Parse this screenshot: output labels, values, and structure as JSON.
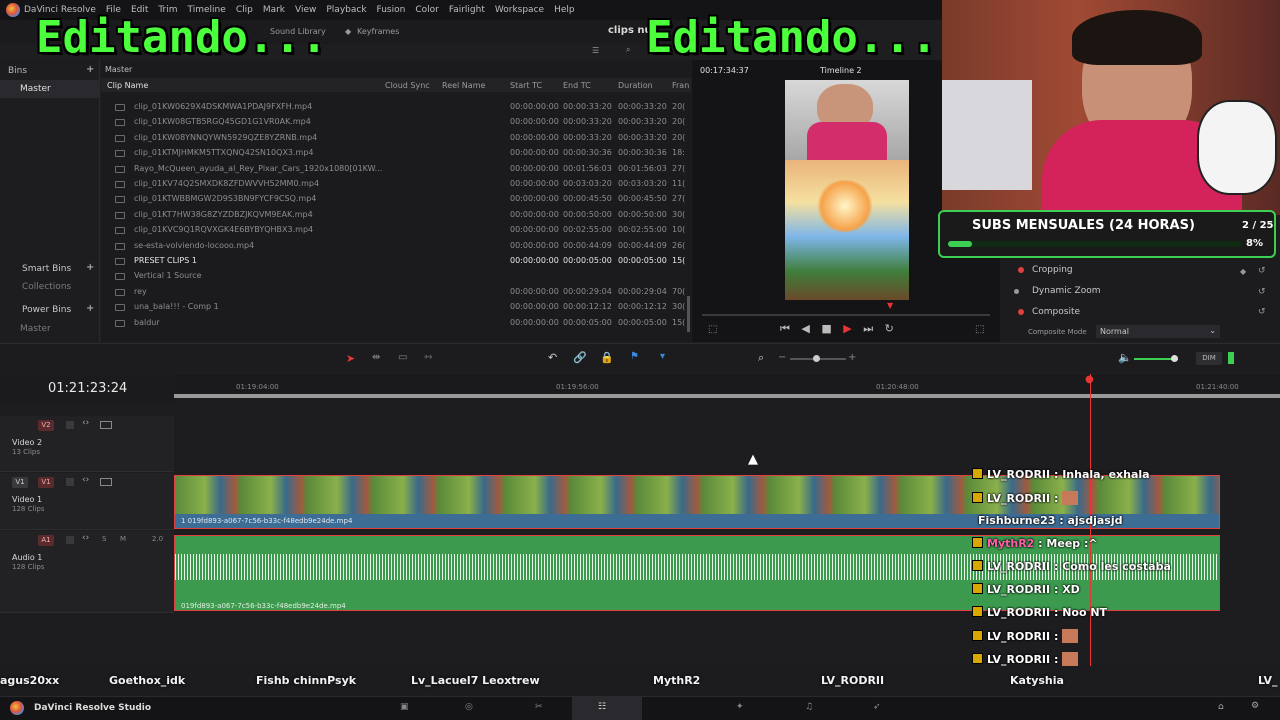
{
  "app": {
    "name": "DaVinci Resolve",
    "taskbar_label": "DaVinci Resolve Studio"
  },
  "menu": [
    "File",
    "Edit",
    "Trim",
    "Timeline",
    "Clip",
    "Mark",
    "View",
    "Playback",
    "Fusion",
    "Color",
    "Fairlight",
    "Workspace",
    "Help"
  ],
  "toolbar": {
    "sound_library": "Sound Library",
    "keyframes": "Keyframes",
    "project_title": "clips nue"
  },
  "overlay_text": {
    "left": "Editando...",
    "right": "Editando..."
  },
  "bins": {
    "header": "Bins",
    "master": "Master",
    "smart_bins": "Smart Bins",
    "collections": "Collections",
    "power_bins": "Power Bins",
    "power_master": "Master"
  },
  "pool": {
    "breadcrumb": "Master",
    "columns": [
      "Clip Name",
      "Cloud Sync",
      "Reel Name",
      "Start TC",
      "End TC",
      "Duration",
      "Fran"
    ],
    "clips": [
      {
        "name": "clip_01KW0629X4DSKMWA1PDAJ9FXFH.mp4",
        "start": "00:00:00:00",
        "end": "00:00:33:20",
        "dur": "00:00:33:20",
        "fr": "20("
      },
      {
        "name": "clip_01KW08GTB5RGQ45GD1G1VR0AK.mp4",
        "start": "00:00:00:00",
        "end": "00:00:33:20",
        "dur": "00:00:33:20",
        "fr": "20("
      },
      {
        "name": "clip_01KW08YNNQYWN5929QZE8YZRNB.mp4",
        "start": "00:00:00:00",
        "end": "00:00:33:20",
        "dur": "00:00:33:20",
        "fr": "20("
      },
      {
        "name": "clip_01KTMJHMKM5TTXQNQ42SN10QX3.mp4",
        "start": "00:00:00:00",
        "end": "00:00:30:36",
        "dur": "00:00:30:36",
        "fr": "18:"
      },
      {
        "name": "Rayo_McQueen_ayuda_al_Rey_Pixar_Cars_1920x1080[01KW...",
        "start": "00:00:00:00",
        "end": "00:01:56:03",
        "dur": "00:01:56:03",
        "fr": "27("
      },
      {
        "name": "clip_01KV74Q2SMXDK8ZFDWVVH52MM0.mp4",
        "start": "00:00:00:00",
        "end": "00:03:03:20",
        "dur": "00:03:03:20",
        "fr": "11("
      },
      {
        "name": "clip_01KTWBBMGW2D9S3BN9FYCF9CSQ.mp4",
        "start": "00:00:00:00",
        "end": "00:00:45:50",
        "dur": "00:00:45:50",
        "fr": "27("
      },
      {
        "name": "clip_01KT7HW38G8ZYZDBZJKQVM9EAK.mp4",
        "start": "00:00:00:00",
        "end": "00:00:50:00",
        "dur": "00:00:50:00",
        "fr": "30("
      },
      {
        "name": "clip_01KVC9Q1RQVXGK4E6BYBYQHBX3.mp4",
        "start": "00:00:00:00",
        "end": "00:02:55:00",
        "dur": "00:02:55:00",
        "fr": "10("
      },
      {
        "name": "se-esta-volviendo-locooo.mp4",
        "start": "00:00:00:00",
        "end": "00:00:44:09",
        "dur": "00:00:44:09",
        "fr": "26("
      },
      {
        "name": "PRESET CLIPS 1",
        "start": "00:00:00:00",
        "end": "00:00:05:00",
        "dur": "00:00:05:00",
        "fr": "15(",
        "highlight": true
      },
      {
        "name": "Vertical 1 Source",
        "start": "",
        "end": "",
        "dur": "",
        "fr": ""
      },
      {
        "name": "rey",
        "start": "00:00:00:00",
        "end": "00:00:29:04",
        "dur": "00:00:29:04",
        "fr": "70("
      },
      {
        "name": "una_bala!!! - Comp 1",
        "start": "00:00:00:00",
        "end": "00:00:12:12",
        "dur": "00:00:12:12",
        "fr": "30("
      },
      {
        "name": "baldur",
        "start": "00:00:00:00",
        "end": "00:00:05:00",
        "dur": "00:00:05:00",
        "fr": "15("
      }
    ]
  },
  "viewer": {
    "timecode": "00:17:34:37",
    "timeline_name": "Timeline 2"
  },
  "subs_widget": {
    "title": "SUBS MENSUALES (24 HORAS)",
    "count": "2 / 25",
    "percent": "8%",
    "progress": 0.08
  },
  "inspector": {
    "items": [
      "Cropping",
      "Dynamic Zoom",
      "Composite"
    ],
    "composite_mode_label": "Composite Mode",
    "composite_mode_value": "Normal"
  },
  "timeline": {
    "timecode": "01:21:23:24",
    "ruler": [
      "01:19:04:00",
      "01:19:56:00",
      "01:20:48:00",
      "01:21:40:00"
    ],
    "tracks": [
      {
        "id": "V2",
        "name": "Video 2",
        "count": "13 Clips"
      },
      {
        "id": "V1",
        "name": "Video 1",
        "count": "128 Clips"
      },
      {
        "id": "A1",
        "name": "Audio 1",
        "count": "128 Clips",
        "level": "2.0"
      }
    ],
    "video_clip_label": "1 019fd893-a067-7c56-b33c-f48edb9e24de.mp4",
    "audio_clip_label": "019fd893-a067-7c56-b33c-f48edb9e24de.mp4",
    "dim_label": "DIM"
  },
  "chat": [
    {
      "user": "LV_RODRII",
      "msg": "Inhala, exhala",
      "badge": true
    },
    {
      "user": "LV_RODRII",
      "msg": "",
      "badge": true,
      "emote": true
    },
    {
      "user": "Fishburne23",
      "msg": "ajsdjasjd",
      "badge": false
    },
    {
      "user": "MythR2",
      "msg": "Meep :^",
      "badge": true,
      "pink": true
    },
    {
      "user": "LV_RODRII",
      "msg": "Como les costaba",
      "badge": true
    },
    {
      "user": "LV_RODRII",
      "msg": "XD",
      "badge": true
    },
    {
      "user": "LV_RODRII",
      "msg": "Noo NT",
      "badge": true
    },
    {
      "user": "LV_RODRII",
      "msg": "",
      "badge": true,
      "emote": true
    },
    {
      "user": "LV_RODRII",
      "msg": "",
      "badge": true,
      "emote": true
    }
  ],
  "viewers_bar": [
    "agus20xx",
    "Goethox_idk",
    "Fishb chinnPsyk",
    "Lv_Lacuel7 Leoxtrew",
    "MythR2",
    "LV_RODRII",
    "Katyshia",
    "LV_"
  ],
  "colors": {
    "accent_green": "#4cff3c",
    "chat_badge": "#d9a800",
    "subs_border": "#3ccf54",
    "playhead": "#e83434"
  }
}
